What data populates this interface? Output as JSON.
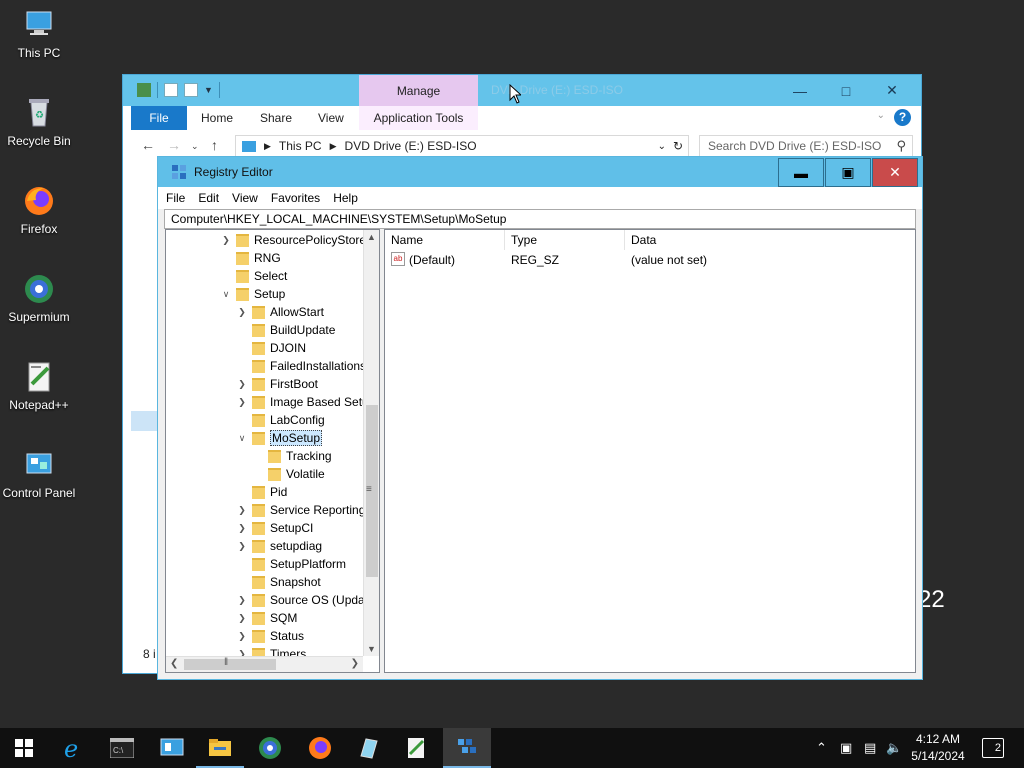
{
  "desktop": {
    "icons": [
      {
        "label": "This PC",
        "icon": "this-pc-icon"
      },
      {
        "label": "Recycle Bin",
        "icon": "recycle-bin-icon"
      },
      {
        "label": "Firefox",
        "icon": "firefox-icon"
      },
      {
        "label": "Supermium",
        "icon": "supermium-icon"
      },
      {
        "label": "Notepad++",
        "icon": "notepadpp-icon"
      },
      {
        "label": "Control Panel",
        "icon": "control-panel-icon"
      }
    ],
    "background_fragment": "22"
  },
  "explorer": {
    "title": "DVD Drive (E:) ESD-ISO",
    "manage_tab": "Manage",
    "ribbon_tabs": {
      "file": "File",
      "home": "Home",
      "share": "Share",
      "view": "View",
      "app_tools": "Application Tools"
    },
    "address": {
      "root": "This PC",
      "location": "DVD Drive (E:) ESD-ISO"
    },
    "search_placeholder": "Search DVD Drive (E:) ESD-ISO",
    "status_fragment": "8 i"
  },
  "regedit": {
    "title": "Registry Editor",
    "menu": [
      "File",
      "Edit",
      "View",
      "Favorites",
      "Help"
    ],
    "path": "Computer\\HKEY_LOCAL_MACHINE\\SYSTEM\\Setup\\MoSetup",
    "tree": [
      {
        "label": "ResourcePolicyStore",
        "level": 0,
        "arrow": "right"
      },
      {
        "label": "RNG",
        "level": 0,
        "arrow": ""
      },
      {
        "label": "Select",
        "level": 0,
        "arrow": ""
      },
      {
        "label": "Setup",
        "level": 0,
        "arrow": "down"
      },
      {
        "label": "AllowStart",
        "level": 1,
        "arrow": "right"
      },
      {
        "label": "BuildUpdate",
        "level": 1,
        "arrow": ""
      },
      {
        "label": "DJOIN",
        "level": 1,
        "arrow": ""
      },
      {
        "label": "FailedInstallations",
        "level": 1,
        "arrow": ""
      },
      {
        "label": "FirstBoot",
        "level": 1,
        "arrow": "right"
      },
      {
        "label": "Image Based Setup",
        "level": 1,
        "arrow": "right"
      },
      {
        "label": "LabConfig",
        "level": 1,
        "arrow": ""
      },
      {
        "label": "MoSetup",
        "level": 1,
        "arrow": "down",
        "selected": true
      },
      {
        "label": "Tracking",
        "level": 2,
        "arrow": ""
      },
      {
        "label": "Volatile",
        "level": 2,
        "arrow": ""
      },
      {
        "label": "Pid",
        "level": 1,
        "arrow": ""
      },
      {
        "label": "Service Reporting",
        "level": 1,
        "arrow": "right"
      },
      {
        "label": "SetupCI",
        "level": 1,
        "arrow": "right"
      },
      {
        "label": "setupdiag",
        "level": 1,
        "arrow": "right"
      },
      {
        "label": "SetupPlatform",
        "level": 1,
        "arrow": ""
      },
      {
        "label": "Snapshot",
        "level": 1,
        "arrow": ""
      },
      {
        "label": "Source OS (Updated)",
        "level": 1,
        "arrow": "right"
      },
      {
        "label": "SQM",
        "level": 1,
        "arrow": "right"
      },
      {
        "label": "Status",
        "level": 1,
        "arrow": "right"
      },
      {
        "label": "Timers",
        "level": 1,
        "arrow": "right"
      }
    ],
    "columns": {
      "name": "Name",
      "type": "Type",
      "data": "Data"
    },
    "values": [
      {
        "name": "(Default)",
        "type": "REG_SZ",
        "data": "(value not set)"
      }
    ]
  },
  "taskbar": {
    "apps": [
      "start-icon",
      "ie-icon",
      "cmd-icon",
      "server-manager-icon",
      "file-explorer-icon",
      "supermium-icon",
      "firefox-icon",
      "tablet-icon",
      "notepadpp-icon",
      "regedit-icon"
    ],
    "active_app": "regedit-icon",
    "time": "4:12 AM",
    "date": "5/14/2024",
    "notification_count": "2"
  },
  "colors": {
    "accent": "#64c3ea",
    "close": "#c94b4b",
    "file_tab": "#1979ca",
    "manage": "#e6c8ef"
  }
}
